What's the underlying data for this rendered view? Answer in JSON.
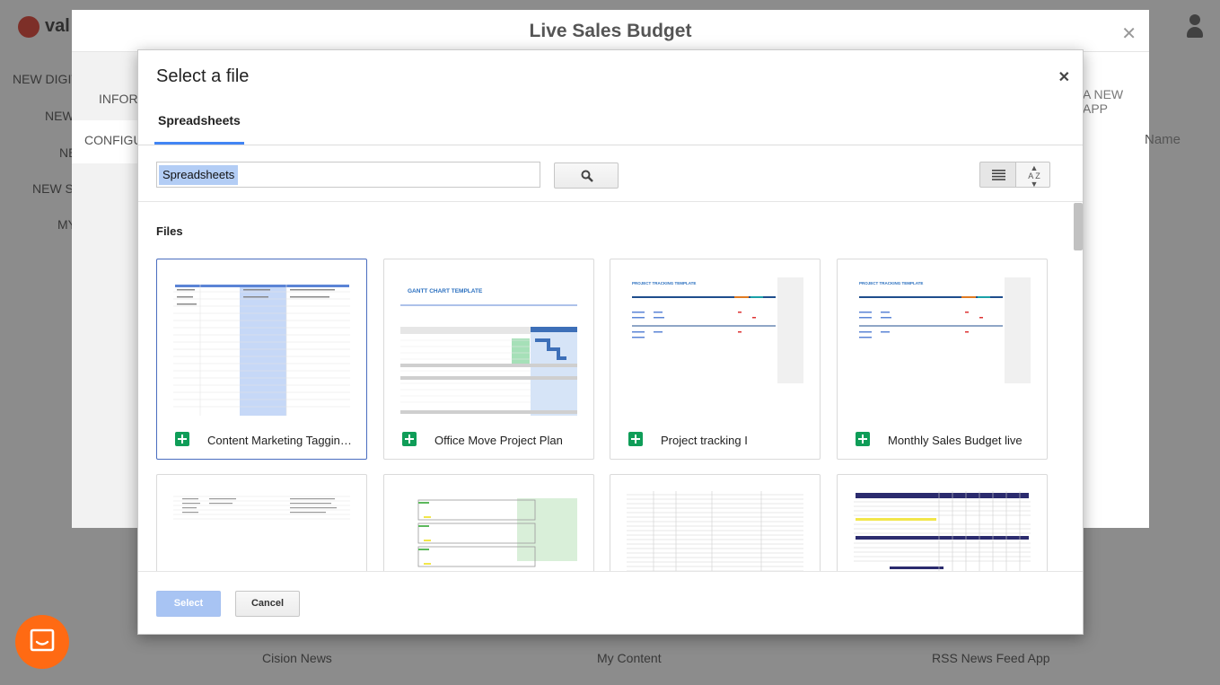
{
  "background_app": {
    "logo_text": "val",
    "left_menu": [
      "NEW DIGIT",
      "NEW",
      "NE",
      "NEW ST",
      "MY"
    ],
    "right_button": "A NEW APP",
    "sort_label": "Name",
    "bottom_apps": [
      "Cision News",
      "My Content",
      "RSS News Feed App"
    ]
  },
  "outer_modal": {
    "title": "Live Sales Budget",
    "side_tabs": [
      "INFORM",
      "CONFIGU"
    ],
    "side_letter": "A"
  },
  "picker": {
    "title": "Select a file",
    "active_tab": "Spreadsheets",
    "search_value": "Spreadsheets",
    "section_label": "Files",
    "files": [
      {
        "name": "Content Marketing Tagging..."
      },
      {
        "name": "Office Move Project Plan"
      },
      {
        "name": "Project tracking I"
      },
      {
        "name": "Monthly Sales Budget live"
      },
      {
        "name": ""
      },
      {
        "name": ""
      },
      {
        "name": ""
      },
      {
        "name": ""
      }
    ],
    "thumb_text": {
      "gantt_title": "GANTT CHART TEMPLATE",
      "tracking_title": "PROJECT TRACKING TEMPLATE"
    },
    "select_label": "Select",
    "cancel_label": "Cancel"
  },
  "colors": {
    "accent": "#4285f4",
    "sheets_green": "#0f9d58",
    "chat_orange": "#ff6a13",
    "select_disabled": "#a8c4f3"
  },
  "icons": [
    "search-icon",
    "list-view-icon",
    "sort-az-icon",
    "close-icon",
    "spreadsheet-icon",
    "chat-icon"
  ]
}
